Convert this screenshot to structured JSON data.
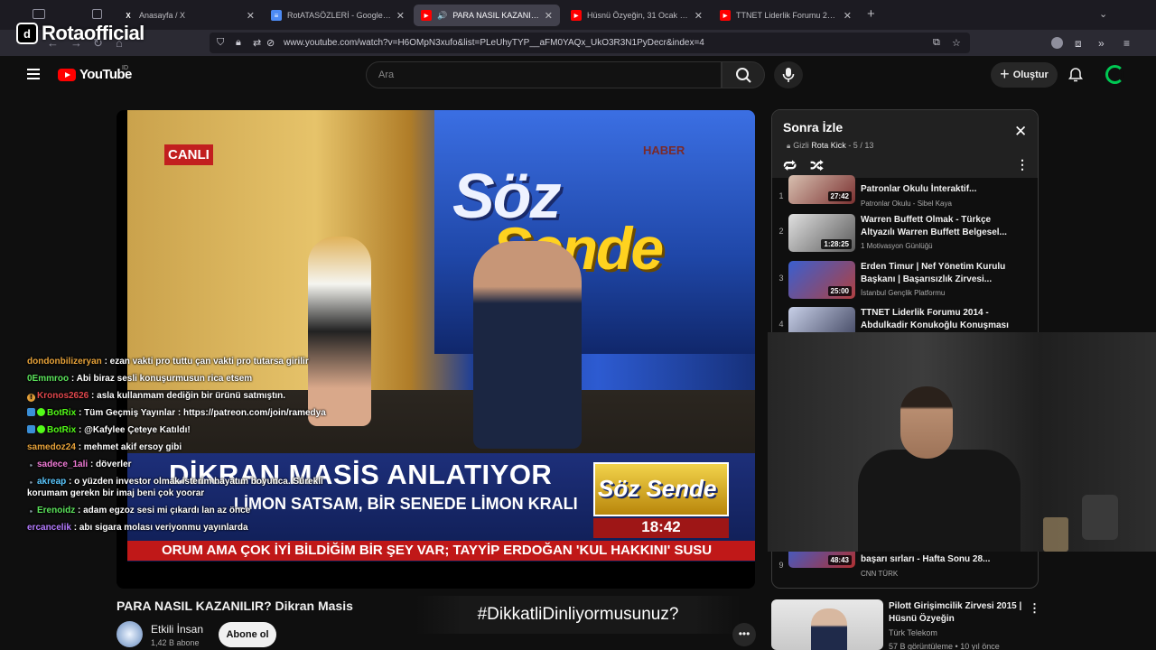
{
  "overlay": {
    "logo_text": "Rotaofficial",
    "logo_glyph": "d"
  },
  "browser": {
    "tabs": [
      {
        "title": "Anasayfa / X",
        "favicon": "X",
        "color": "#ffffff",
        "active": false
      },
      {
        "title": "RotATASÖZLERİ - Google Dokü",
        "favicon": "≡",
        "color": "#4d8bf5",
        "active": false
      },
      {
        "title": "PARA NASIL KAZANILIR? D",
        "favicon": "▶",
        "color": "#ff0000",
        "active": true
      },
      {
        "title": "Hüsnü Özyeğin, 31 Ocak 2017 F",
        "favicon": "▶",
        "color": "#ff0000",
        "active": false
      },
      {
        "title": "TTNET Liderlik Forumu 2014 - A",
        "favicon": "▶",
        "color": "#ff0000",
        "active": false
      }
    ],
    "url": "www.youtube.com/watch?v=H6OMpN3xufo&list=PLeUhyTYP__aFM0YAQx_UkO3R3N1PyDecr&index=4"
  },
  "youtube": {
    "logo_text": "YouTube",
    "country_code": "ID",
    "search_placeholder": "Ara",
    "create_label": "Oluştur"
  },
  "video": {
    "live_badge": "CANLI",
    "channel_bug": "HABER",
    "show_word1": "Söz",
    "show_word2": "Sende",
    "caption_title": "DİKRAN MASİS ANLATIYOR",
    "caption_sub": "LİMON SATSAM, BİR SENEDE LİMON KRALI",
    "caption_box": "Söz Sende",
    "caption_time": "18:42",
    "ticker": "ORUM AMA ÇOK İYİ BİLDİĞİM BİR ŞEY VAR; TAYYİP ERDOĞAN 'KUL HAKKINI' SUSU",
    "title": "PARA NASIL KAZANILIR? Dikran Masis",
    "channel": "Etkili İnsan",
    "subscribers": "1,42 B abone",
    "subscribe_label": "Abone ol",
    "more_label": "•••",
    "hashtag": "#DikkatliDinliyormusunuz?"
  },
  "chat": [
    {
      "user": "dondonbilizeryan",
      "color": "#e8a33a",
      "badge": "",
      "text": ": ezan vakti pro tuttu çan vakti pro tutarsa girilir"
    },
    {
      "user": "0Emmroo",
      "color": "#5be35b",
      "badge": "",
      "text": ": Abi biraz sesli konuşurmusun rica etsem"
    },
    {
      "user": "Kronos2626",
      "color": "#e0474c",
      "badge": "!",
      "text": ": asla kullanmam dediğin bir ürünü satmıştın."
    },
    {
      "user": "BotRix",
      "color": "#53fc18",
      "badge": "bot",
      "text": ": Tüm Geçmiş Yayınlar : https://patreon.com/join/ramedya"
    },
    {
      "user": "BotRix",
      "color": "#53fc18",
      "badge": "bot",
      "text": ": @Kafylee Çeteye Katıldı!"
    },
    {
      "user": "samedoz24",
      "color": "#e8a33a",
      "badge": "",
      "text": ": mehmet akif ersoy gibi"
    },
    {
      "user": "sadece_1ali",
      "color": "#f07bd6",
      "badge": "sub",
      "text": ": döverler"
    },
    {
      "user": "akreap",
      "color": "#5bc8ff",
      "badge": "sub",
      "text": ": o yüzden investor olmak isterim hayatım boyunca. Sürekli korumam gerekn bir imaj beni çok yoorar"
    },
    {
      "user": "Erenoidz",
      "color": "#5be35b",
      "badge": "sub",
      "text": ": adam egzoz sesi mi çıkardı lan az önce"
    },
    {
      "user": "ercancelik",
      "color": "#b47bff",
      "badge": "",
      "text": ": abı sigara molası veriyonmu yayınlarda"
    }
  ],
  "playlist": {
    "title": "Sonra İzle",
    "privacy": "Gizli",
    "owner": "Rota Kick",
    "position": "- 5 / 13",
    "items": [
      {
        "index": "1",
        "title": "Patronlar Okulu İnteraktif...",
        "channel": "Patronlar Okulu - Sibel Kaya",
        "duration": "27:42"
      },
      {
        "index": "2",
        "title": "Warren Buffett Olmak - Türkçe Altyazılı Warren Buffett Belgesel...",
        "channel": "1 Motivasyon Günlüğü",
        "duration": "1:28:25"
      },
      {
        "index": "3",
        "title": "Erden Timur | Nef Yönetim Kurulu Başkanı | Başarısızlık Zirvesi...",
        "channel": "İstanbul Gençlik Platformu",
        "duration": "25:00"
      },
      {
        "index": "4",
        "title": "TTNET Liderlik Forumu 2014 - Abdulkadir Konukoğlu Konuşması",
        "channel": "",
        "duration": ""
      },
      {
        "index": "9",
        "title": "başarı sırları - Hafta Sonu 28...",
        "channel": "CNN TÜRK",
        "duration": "48:43"
      }
    ]
  },
  "related": {
    "title": "Pilott Girişimcilik Zirvesi 2015 | Hüsnü Özyeğin",
    "channel": "Türk Telekom",
    "meta": "57 B görüntüleme • 10 yıl önce"
  }
}
